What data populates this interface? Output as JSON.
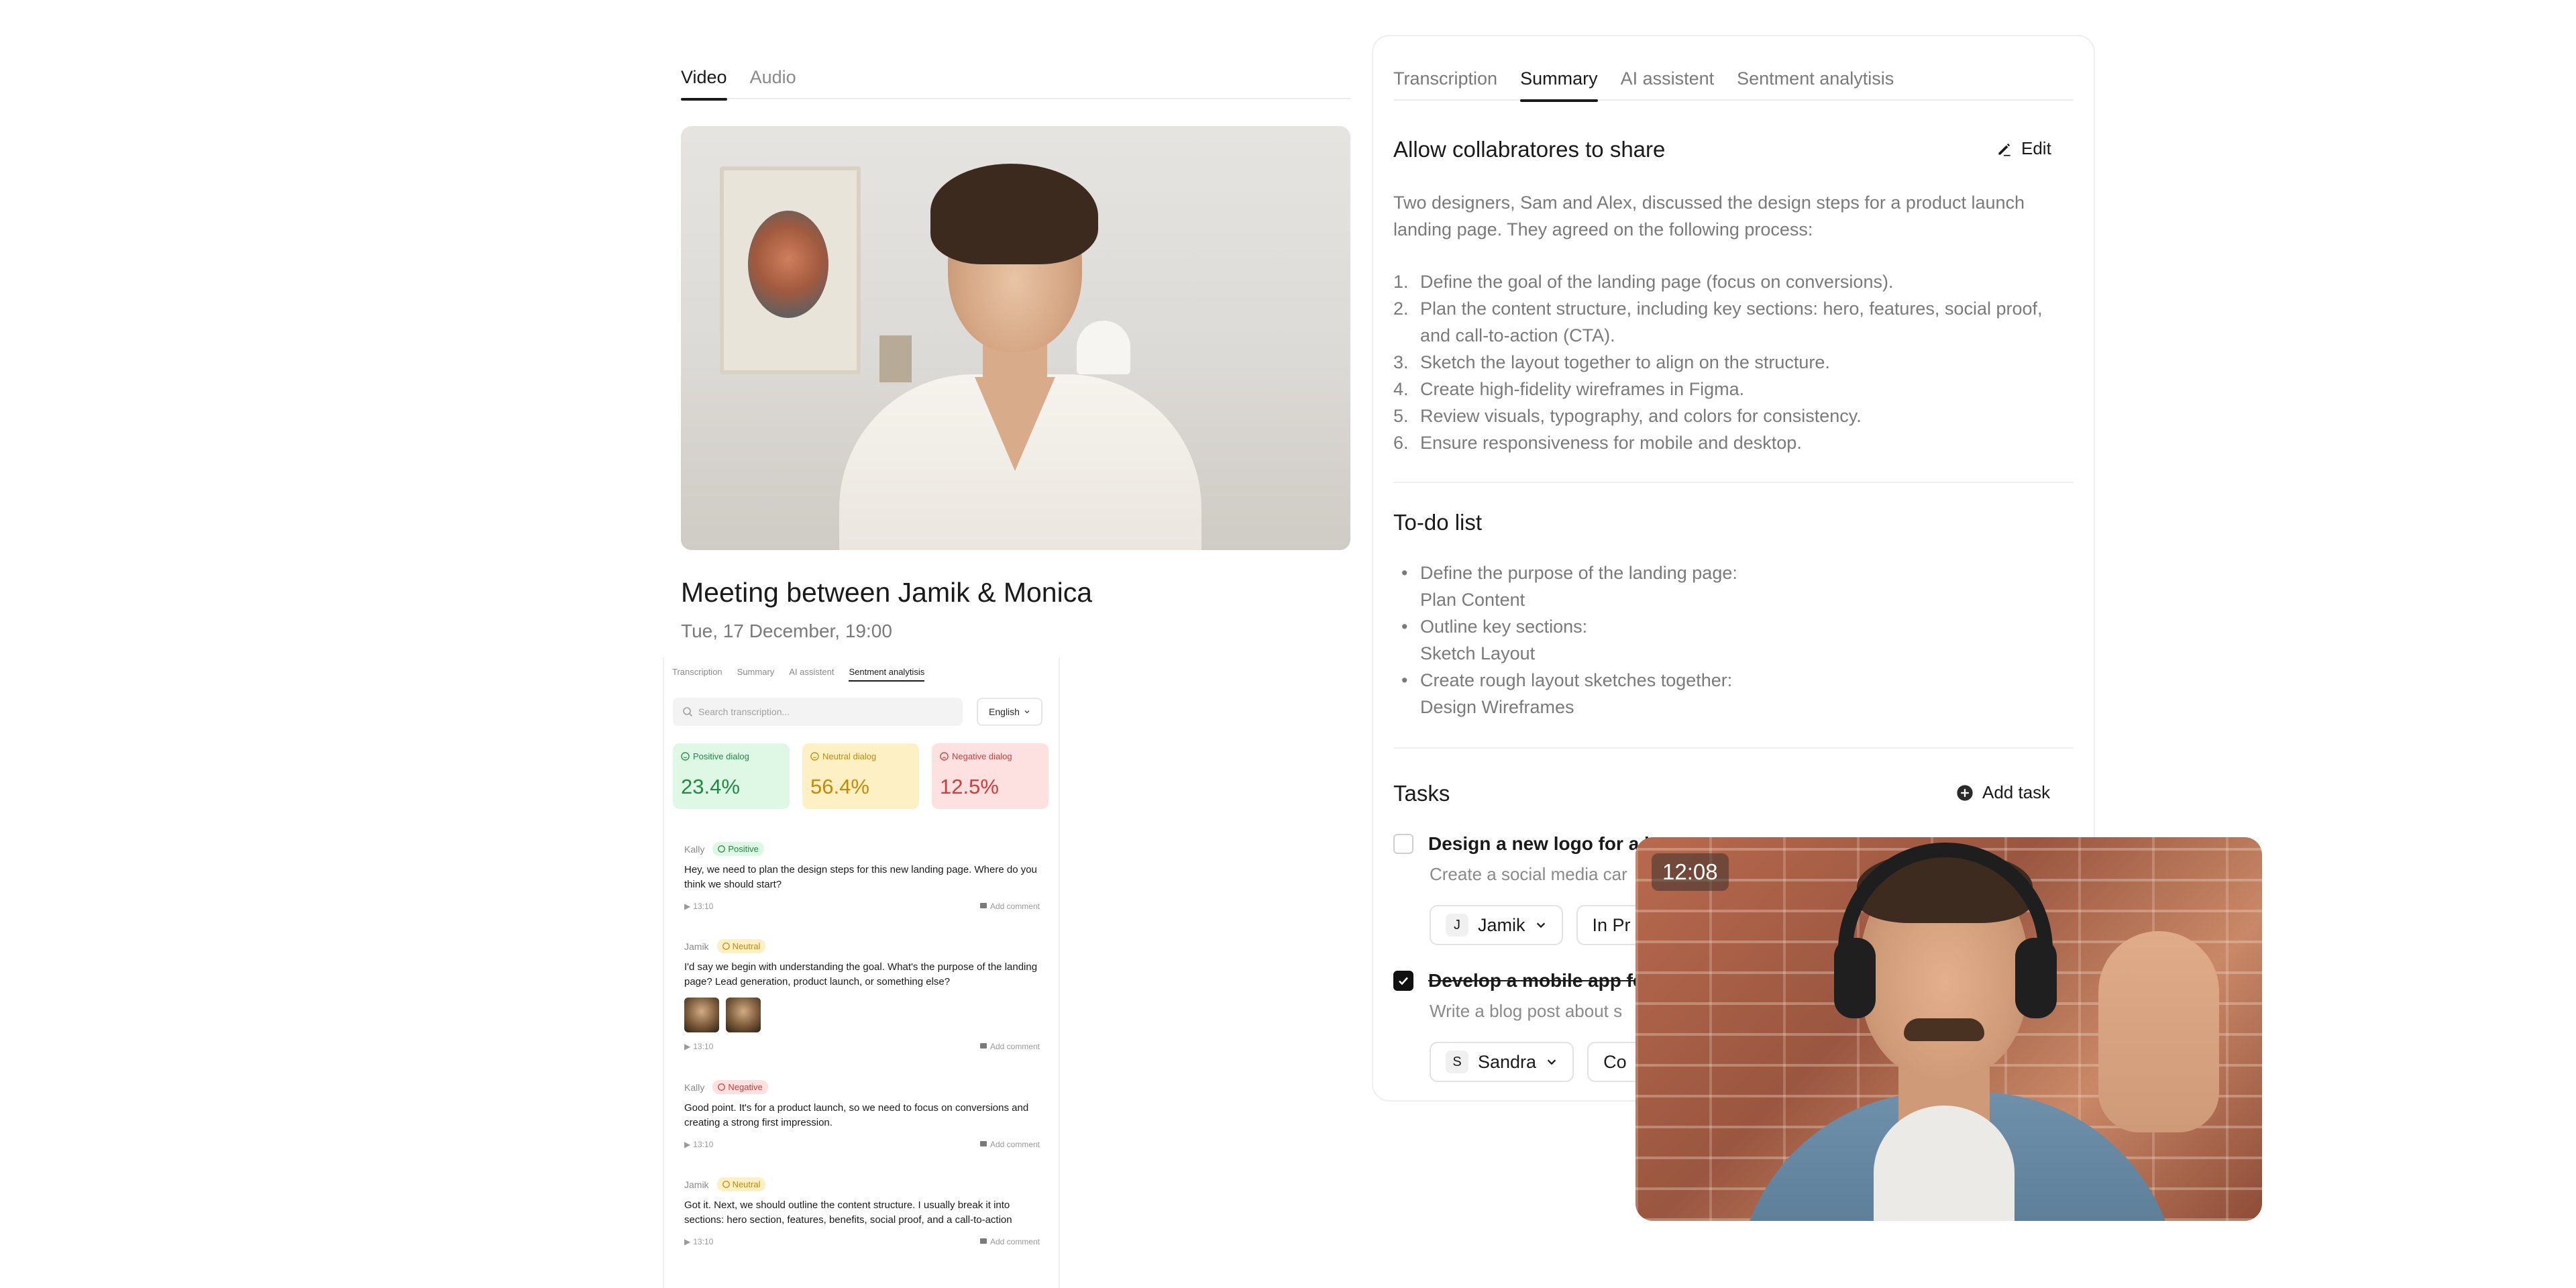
{
  "media": {
    "tabs": [
      {
        "label": "Video",
        "active": true
      },
      {
        "label": "Audio",
        "active": false
      }
    ],
    "title": "Meeting between Jamik & Monica",
    "date": "Tue, 17 December, 19:00"
  },
  "mini": {
    "tabs": [
      {
        "label": "Transcription",
        "active": false
      },
      {
        "label": "Summary",
        "active": false
      },
      {
        "label": "AI assistent",
        "active": false
      },
      {
        "label": "Sentment analytisis",
        "active": true
      }
    ],
    "search_placeholder": "Search transcription...",
    "language": "English",
    "stats": [
      {
        "label": "Positive dialog",
        "value": "23.4%",
        "kind": "positive",
        "color": "#1f8a44"
      },
      {
        "label": "Neutral dialog",
        "value": "56.4%",
        "kind": "neutral",
        "color": "#c58a06"
      },
      {
        "label": "Negative dialog",
        "value": "12.5%",
        "kind": "negative",
        "color": "#d23c3c"
      }
    ],
    "entries": [
      {
        "speaker": "Kally",
        "sentiment": "Positive",
        "text": "Hey, we need to plan the design steps for this new landing page. Where do you think we should start?",
        "time": "13:10",
        "comment": "Add comment"
      },
      {
        "speaker": "Jamik",
        "sentiment": "Neutral",
        "text": "I'd say we begin with understanding the goal. What's the purpose of the landing page? Lead generation, product launch, or something else?",
        "time": "13:10",
        "comment": "Add comment"
      },
      {
        "speaker": "Kally",
        "sentiment": "Negative",
        "text": "Good point. It's for a product launch, so we need to focus on conversions and creating a strong first impression.",
        "time": "13:10",
        "comment": "Add comment"
      },
      {
        "speaker": "Jamik",
        "sentiment": "Neutral",
        "text": "Got it. Next, we should outline the content structure. I usually break it into sections: hero section, features, benefits, social proof, and a call-to-action",
        "time": "13:10",
        "comment": "Add comment"
      }
    ]
  },
  "panel": {
    "tabs": [
      {
        "label": "Transcription",
        "active": false
      },
      {
        "label": "Summary",
        "active": true
      },
      {
        "label": "AI assistent",
        "active": false
      },
      {
        "label": "Sentment analytisis",
        "active": false
      }
    ],
    "summary_title": "Allow collabratores to share",
    "edit_label": "Edit",
    "summary_text": "Two designers, Sam and Alex, discussed the design steps for a product launch landing page. They agreed on the following process:",
    "steps": [
      "Define the goal of the landing page (focus on conversions).",
      "Plan the content structure, including key sections: hero, features, social proof, and call-to-action (CTA).",
      "Sketch the layout together to align on the structure.",
      "Create high-fidelity wireframes in Figma.",
      "Review visuals, typography, and colors for consistency.",
      "Ensure responsiveness for mobile and desktop."
    ],
    "todo_title": "To-do list",
    "todos": [
      {
        "text": "Define the purpose of the landing page:",
        "sub": "Plan Content"
      },
      {
        "text": "Outline key sections:",
        "sub": "Sketch Layout"
      },
      {
        "text": "Create rough layout sketches together:",
        "sub": "Design Wireframes"
      }
    ],
    "tasks_title": "Tasks",
    "add_task_label": "Add task",
    "tasks": [
      {
        "title": "Design a new logo for a l",
        "desc": "Create a social media car",
        "done": false,
        "assignee_initial": "J",
        "assignee": "Jamik",
        "status": "In Pr"
      },
      {
        "title": "Develop a mobile app fe",
        "desc": "Write a blog post about s",
        "done": true,
        "assignee_initial": "S",
        "assignee": "Sandra",
        "status": "Co"
      }
    ]
  },
  "call": {
    "time": "12:08"
  }
}
